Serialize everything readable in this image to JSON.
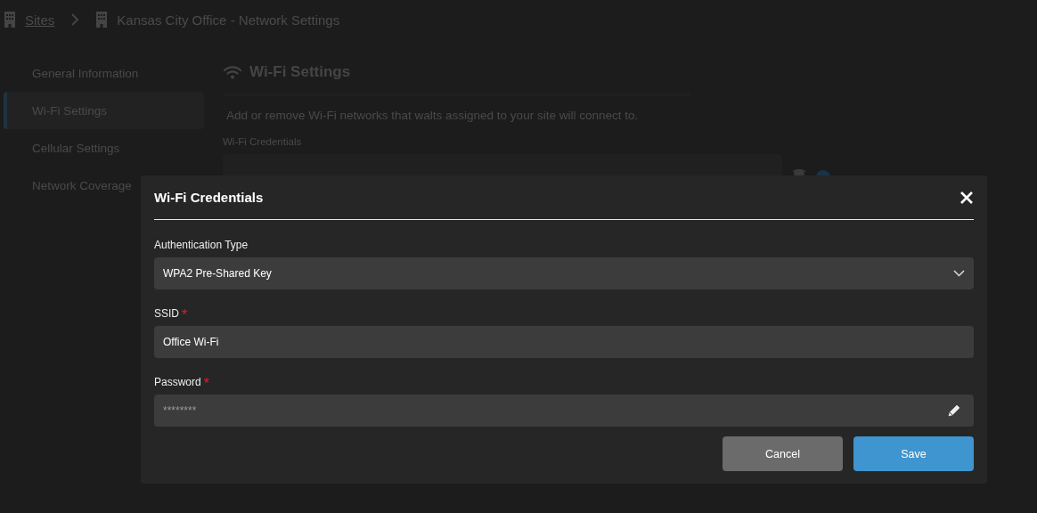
{
  "breadcrumb": [
    {
      "label": "Sites",
      "link": true
    },
    {
      "label": "Kansas City Office - Network Settings",
      "link": false
    }
  ],
  "sidebar": {
    "items": [
      {
        "label": "General Information",
        "selected": false
      },
      {
        "label": "Wi-Fi Settings",
        "selected": true
      },
      {
        "label": "Cellular Settings",
        "selected": false
      },
      {
        "label": "Network Coverage",
        "selected": false
      }
    ]
  },
  "section": {
    "title": "Wi-Fi Settings",
    "description": "Add or remove Wi-Fi networks that walts assigned to your site will connect to.",
    "list_label": "Wi-Fi Credentials"
  },
  "dialog": {
    "title": "Wi-Fi Credentials",
    "fields": [
      {
        "kind": "select",
        "label": "Authentication Type",
        "value": "WPA2 Pre-Shared Key"
      },
      {
        "kind": "text",
        "label": "SSID",
        "required_mark": "*",
        "value": "Office Wi-Fi"
      },
      {
        "kind": "password",
        "label": "Password",
        "required_mark": "*",
        "value": "********"
      }
    ],
    "buttons": [
      {
        "label": "Cancel",
        "kind": "secondary"
      },
      {
        "label": "Save",
        "kind": "primary"
      }
    ]
  }
}
